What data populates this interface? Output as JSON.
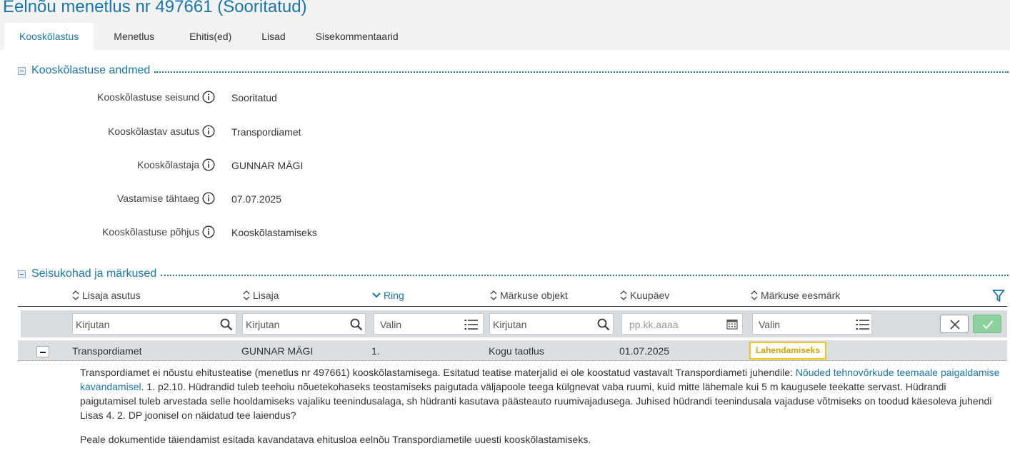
{
  "page": {
    "title": "Eelnõu menetlus nr 497661 (Sooritatud)"
  },
  "tabs": [
    {
      "label": "Kooskõlastus",
      "active": true
    },
    {
      "label": "Menetlus",
      "active": false
    },
    {
      "label": "Ehitis(ed)",
      "active": false
    },
    {
      "label": "Lisad",
      "active": false
    },
    {
      "label": "Sisekommentaarid",
      "active": false
    }
  ],
  "approval_section": {
    "title": "Kooskõlastuse andmed",
    "fields": [
      {
        "label": "Kooskõlastuse seisund",
        "value": "Sooritatud"
      },
      {
        "label": "Kooskõlastav asutus",
        "value": "Transpordiamet"
      },
      {
        "label": "Kooskõlastaja",
        "value": "GUNNAR MÄGI"
      },
      {
        "label": "Vastamise tähtaeg",
        "value": "07.07.2025"
      },
      {
        "label": "Kooskõlastuse põhjus",
        "value": "Kooskõlastamiseks"
      }
    ]
  },
  "remarks_section": {
    "title": "Seisukohad ja märkused",
    "columns": [
      "Lisaja asutus",
      "Lisaja",
      "Ring",
      "Märkuse objekt",
      "Kuupäev",
      "Märkuse eesmärk"
    ],
    "filters": {
      "institution_placeholder": "Kirjutan",
      "author_placeholder": "Kirjutan",
      "round_placeholder": "Valin",
      "object_placeholder": "Kirjutan",
      "date_placeholder": "pp.kk.aaaa",
      "purpose_placeholder": "Valin"
    },
    "row": {
      "institution": "Transpordiamet",
      "author": "GUNNAR MÄGI",
      "round": "1.",
      "object": "Kogu taotlus",
      "date": "01.07.2025",
      "purpose_badge": "Lahendamiseks"
    },
    "detail": {
      "text_before_link": "Transpordiamet ei nõustu ehitusteatise (menetlus nr 497661) kooskõlastamisega. Esitatud teatise materjalid ei ole koostatud vastavalt  Transpordiameti juhendile: ",
      "link_text": "Nõuded tehnovõrkude teemaale paigaldamise kavandamisel",
      "text_after_link": ". 1. p2.10. Hüdrandid tuleb teehoiu nõuetekohaseks teostamiseks paigutada väljapoole teega külgnevat vaba ruumi, kuid mitte lähemale kui 5 m kaugusele teekatte servast. Hüdrandi paigutamisel tuleb arvestada selle hooldamiseks vajaliku teenindusalaga, sh hüdranti kasutava päästeauto ruumivajadusega. Juhised hüdrandi teenindusala vajaduse võtmiseks on toodud käesoleva juhendi Lisas 4. 2. DP joonisel on näidatud tee laiendus?",
      "second_paragraph": "Peale dokumentide täiendamist esitada kavandatava ehitusloa eelnõu Transpordiametile uuesti kooskõlastamiseks."
    }
  },
  "colors": {
    "accent": "#1a76a8",
    "badge": "#f0c419",
    "apply": "#8fd19e"
  }
}
